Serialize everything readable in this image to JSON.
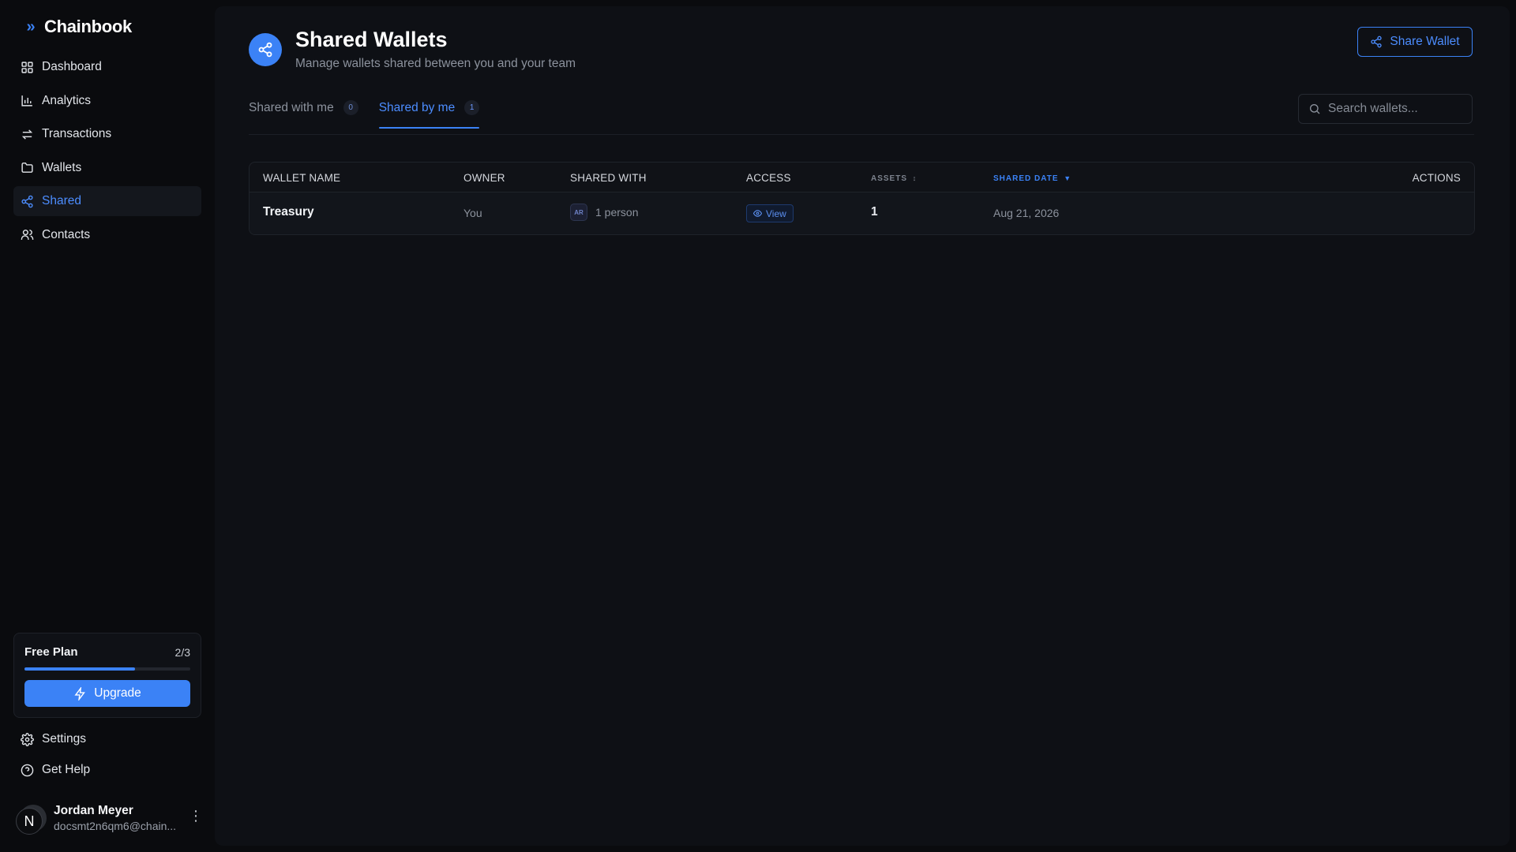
{
  "brand": {
    "name": "Chainbook",
    "icon": "chevrons-right-icon"
  },
  "nav": [
    {
      "label": "Dashboard",
      "icon": "grid-icon",
      "active": false
    },
    {
      "label": "Analytics",
      "icon": "bar-chart-icon",
      "active": false
    },
    {
      "label": "Transactions",
      "icon": "arrows-swap-icon",
      "active": false
    },
    {
      "label": "Wallets",
      "icon": "folder-icon",
      "active": false
    },
    {
      "label": "Shared",
      "icon": "share-icon",
      "active": true
    },
    {
      "label": "Contacts",
      "icon": "users-icon",
      "active": false
    }
  ],
  "plan": {
    "title": "Free Plan",
    "count": "2/3",
    "progress": 0.667,
    "upgrade_label": "Upgrade"
  },
  "bottom_links": {
    "settings": "Settings",
    "help": "Get Help"
  },
  "user": {
    "initial": "N",
    "name": "Jordan Meyer",
    "email": "docsmt2n6qm6@chain..."
  },
  "header": {
    "title": "Shared Wallets",
    "subtitle": "Manage wallets shared between you and your team",
    "share_button": "Share Wallet"
  },
  "tabs": [
    {
      "label": "Shared with me",
      "count": "0",
      "active": false
    },
    {
      "label": "Shared by me",
      "count": "1",
      "active": true
    }
  ],
  "search": {
    "placeholder": "Search wallets..."
  },
  "table": {
    "columns": {
      "wallet_name": "WALLET NAME",
      "owner": "OWNER",
      "shared_with": "SHARED WITH",
      "access": "ACCESS",
      "assets": "ASSETS",
      "assets_sort": "↕",
      "shared_date": "SHARED DATE",
      "shared_date_sort": "▼",
      "actions": "ACTIONS"
    },
    "rows": [
      {
        "wallet_name": "Treasury",
        "owner": "You",
        "shared_initials": "AR",
        "shared_with": "1 person",
        "access": "View",
        "assets": "1",
        "shared_date": "Aug 21, 2026"
      }
    ]
  },
  "colors": {
    "accent": "#3b82f6",
    "background": "#0a0b0e",
    "panel": "#0e1015"
  }
}
